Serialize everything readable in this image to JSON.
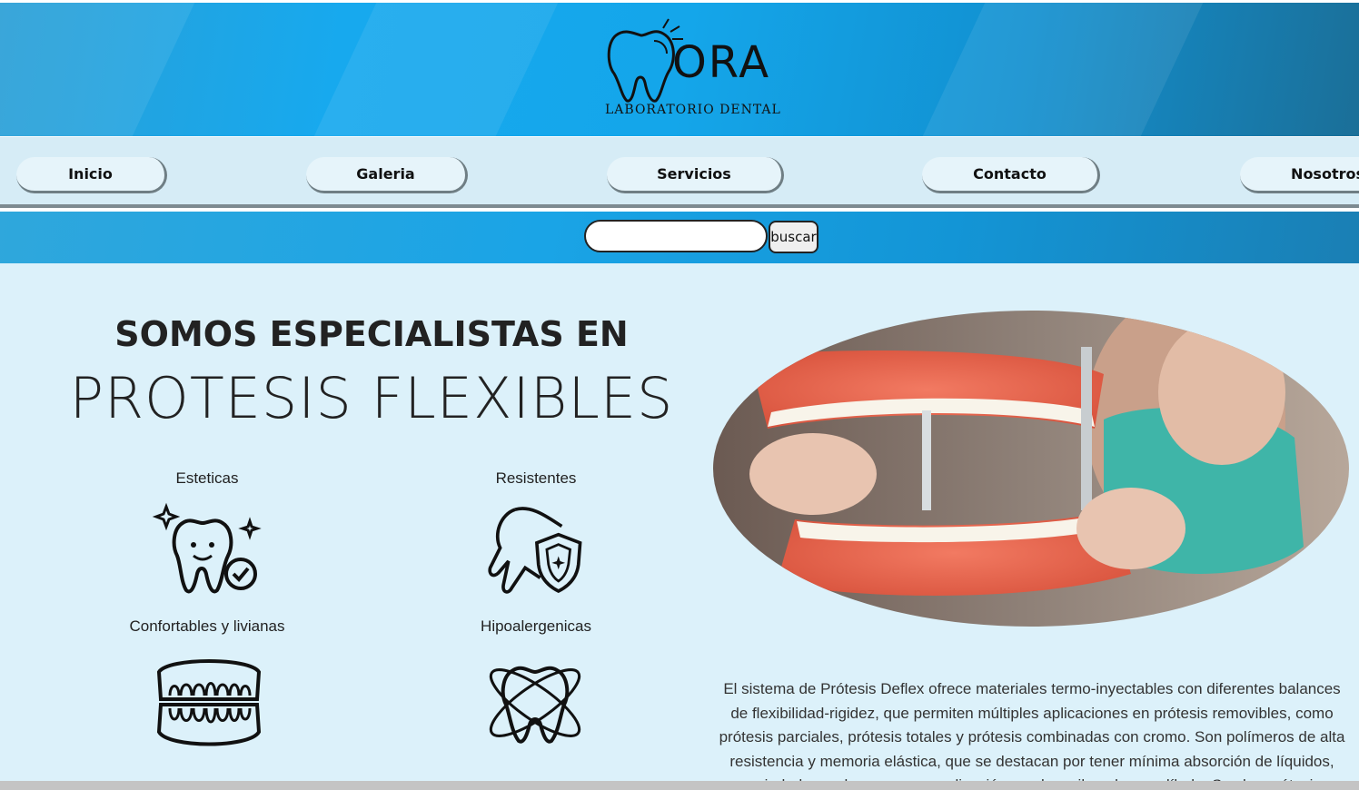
{
  "brand": {
    "logo_word": "ORA",
    "logo_subtitle": "LABORATORIO DENTAL",
    "logo_icon": "tooth-logo-icon"
  },
  "nav": {
    "items": [
      {
        "label": "Inicio"
      },
      {
        "label": "Galeria"
      },
      {
        "label": "Servicios"
      },
      {
        "label": "Contacto"
      },
      {
        "label": "Nosotros"
      }
    ]
  },
  "search": {
    "value": "",
    "button_label": "buscar"
  },
  "hero": {
    "heading_line1": "SOMOS ESPECIALISTAS EN",
    "heading_line2": "PROTESIS FLEXIBLES"
  },
  "features": [
    {
      "label": "Esteticas",
      "icon": "smiling-tooth-icon"
    },
    {
      "label": "Resistentes",
      "icon": "tooth-shield-icon"
    },
    {
      "label": "Confortables y livianas",
      "icon": "denture-icon"
    },
    {
      "label": "Hipoalergenicas",
      "icon": "tooth-atom-icon"
    }
  ],
  "photo": {
    "subject": "dental-prosthesis-photo"
  },
  "description": "El sistema de Prótesis Deflex ofrece materiales termo-inyectables con diferentes balances de flexibilidad-rigidez, que permiten múltiples aplicaciones en prótesis removibles, como prótesis parciales, prótesis totales y prótesis combinadas con cromo. Son polímeros de alta resistencia y memoria elástica, que se destacan por tener mínima absorción de líquidos, variedad en colores para su aplicación en el maxilar y la mandíbula. Sus las prótesis flexibles",
  "colors": {
    "header_blue": "#17a9ee",
    "nav_bg": "#d6ecf6",
    "content_bg": "#dcf1fa",
    "text": "#222222"
  }
}
